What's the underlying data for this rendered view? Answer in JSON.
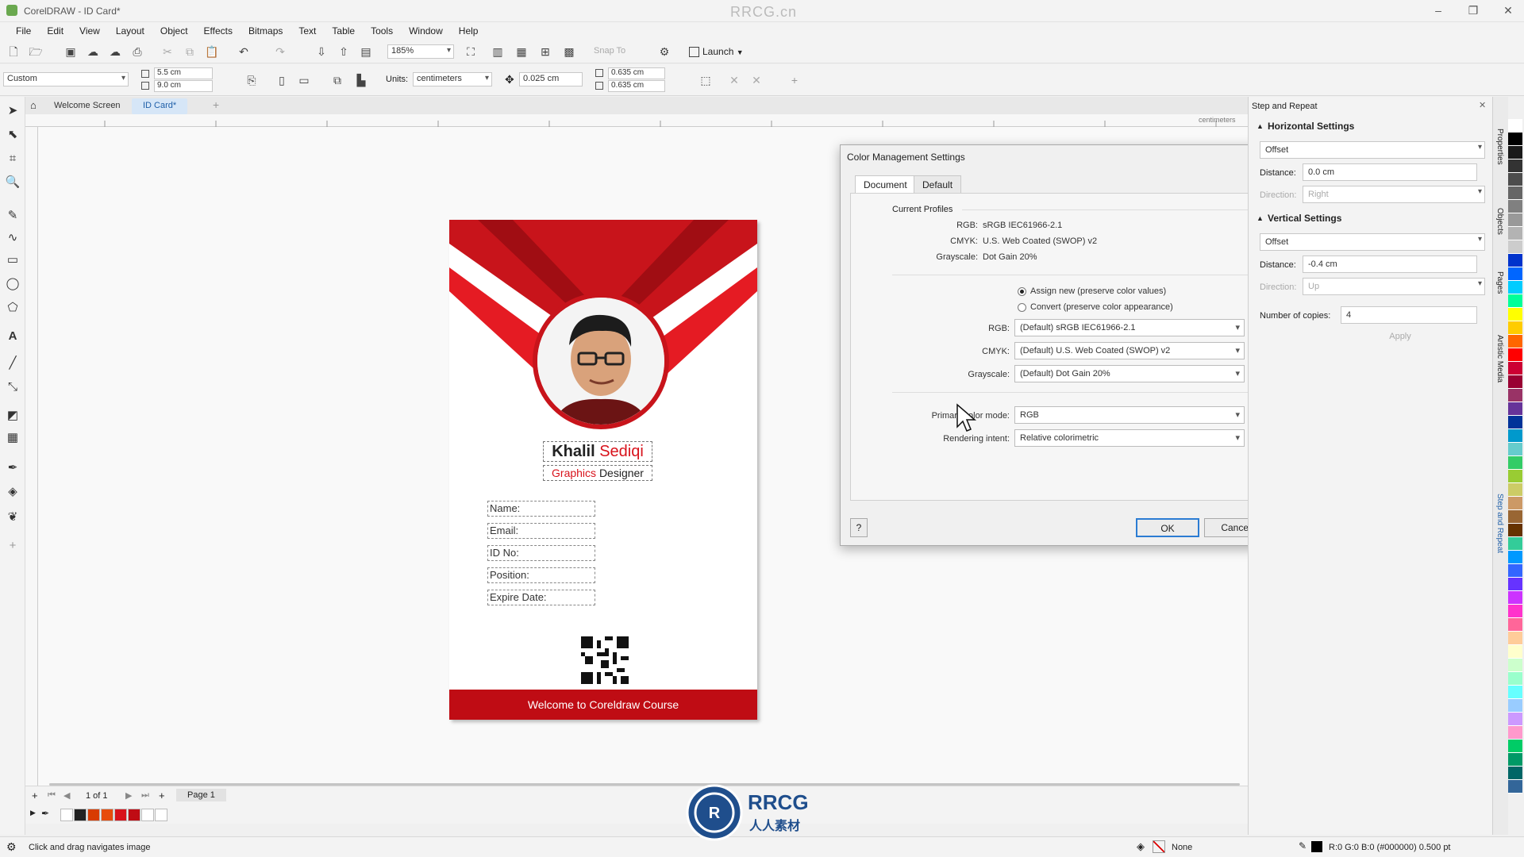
{
  "window": {
    "title": "CorelDRAW - ID Card*",
    "watermark": "RRCG.cn"
  },
  "menus": [
    "File",
    "Edit",
    "View",
    "Layout",
    "Object",
    "Effects",
    "Bitmaps",
    "Text",
    "Table",
    "Tools",
    "Window",
    "Help"
  ],
  "toolbar": {
    "zoom": "185%",
    "launch_label": "Launch",
    "snap_label": "Snap To"
  },
  "propbar": {
    "page_preset": "Custom",
    "width": "5.5 cm",
    "height": "9.0 cm",
    "units_label": "Units:",
    "units_value": "centimeters",
    "nudge": "0.025 cm",
    "dup_x": "0.635 cm",
    "dup_y": "0.635 cm"
  },
  "tabs": {
    "welcome": "Welcome Screen",
    "doc": "ID Card*"
  },
  "ruler_unit": "centimeters",
  "card": {
    "first_name": "Khalil",
    "last_name": "Sediqi",
    "role_highlight": "Graphics",
    "role_rest": "Designer",
    "fields": [
      "Name:",
      "Email:",
      "ID No:",
      "Position:",
      "Expire Date:"
    ],
    "footer": "Welcome to Coreldraw Course",
    "accent": "#d8121b"
  },
  "dialog": {
    "title": "Color Management Settings",
    "tabs": [
      "Document",
      "Default"
    ],
    "current_profiles_label": "Current Profiles",
    "profiles": [
      {
        "label": "RGB:",
        "value": "sRGB IEC61966-2.1"
      },
      {
        "label": "CMYK:",
        "value": "U.S. Web Coated (SWOP) v2"
      },
      {
        "label": "Grayscale:",
        "value": "Dot Gain 20%"
      }
    ],
    "radio_assign": "Assign new (preserve color values)",
    "radio_convert": "Convert (preserve color appearance)",
    "selects": [
      {
        "label": "RGB:",
        "value": "(Default) sRGB IEC61966-2.1"
      },
      {
        "label": "CMYK:",
        "value": "(Default) U.S. Web Coated (SWOP) v2"
      },
      {
        "label": "Grayscale:",
        "value": "(Default) Dot Gain 20%"
      }
    ],
    "primary_mode_label": "Primary color mode:",
    "primary_mode_value": "RGB",
    "intent_label": "Rendering intent:",
    "intent_value": "Relative colorimetric",
    "help_label": "?",
    "ok_label": "OK",
    "cancel_label": "Cancel"
  },
  "docker": {
    "title": "Step and Repeat",
    "horizontal_header": "Horizontal Settings",
    "h_mode": "Offset",
    "h_distance_label": "Distance:",
    "h_distance": "0.0 cm",
    "h_direction_label": "Direction:",
    "h_direction": "Right",
    "vertical_header": "Vertical Settings",
    "v_mode": "Offset",
    "v_distance_label": "Distance:",
    "v_distance": "-0.4 cm",
    "v_direction_label": "Direction:",
    "v_direction": "Up",
    "copies_label": "Number of copies:",
    "copies": "4",
    "apply_label": "Apply"
  },
  "right_tabs": [
    "Properties",
    "Objects",
    "Pages",
    "Artistic Media",
    "Step and Repeat"
  ],
  "pagenav": {
    "counter": "1 of 1",
    "page_tab": "Page 1"
  },
  "status": {
    "hint": "Click and drag navigates image",
    "fill": "None",
    "outline": "R:0 G:0 B:0 (#000000)  0.500 pt"
  },
  "palette_colors": [
    "#ffffff",
    "#000000",
    "#1a1a1a",
    "#333333",
    "#4d4d4d",
    "#666666",
    "#808080",
    "#999999",
    "#b3b3b3",
    "#cccccc",
    "#0033cc",
    "#0066ff",
    "#00ccff",
    "#00ff99",
    "#ffff00",
    "#ffcc00",
    "#ff6600",
    "#ff0000",
    "#cc0033",
    "#990033",
    "#993366",
    "#663399",
    "#003399",
    "#0099cc",
    "#66cccc",
    "#33cc66",
    "#99cc33",
    "#cccc66",
    "#cc9966",
    "#996633",
    "#663300",
    "#33cc99",
    "#0099ff",
    "#3366ff",
    "#6633ff",
    "#cc33ff",
    "#ff33cc",
    "#ff6699",
    "#ffcc99",
    "#ffffcc",
    "#ccffcc",
    "#99ffcc",
    "#66ffff",
    "#99ccff",
    "#cc99ff",
    "#ff99cc",
    "#00cc66",
    "#009966",
    "#006666",
    "#336699"
  ],
  "doc_palette": [
    "#ffffff",
    "#222222",
    "#d83b01",
    "#e74c0c",
    "#d8121b",
    "#bf0c14",
    "#ffffff",
    "#ffffff"
  ]
}
